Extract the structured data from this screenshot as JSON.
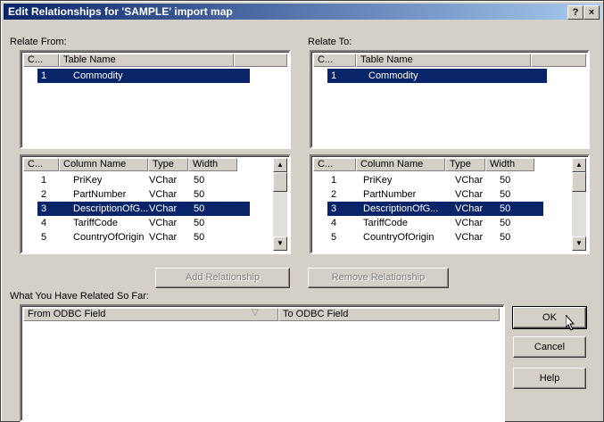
{
  "window": {
    "title": "Edit Relationships for 'SAMPLE' import map",
    "help_btn": "?",
    "close_btn": "×"
  },
  "relate_from": {
    "label": "Relate From:",
    "tables_header": [
      "C...",
      "Table Name"
    ],
    "tables": [
      {
        "c": "1",
        "name": "Commodity"
      }
    ],
    "columns_header": [
      "C...",
      "Column Name",
      "Type",
      "Width"
    ],
    "columns": [
      {
        "c": "1",
        "name": "PriKey",
        "type": "VChar",
        "width": "50"
      },
      {
        "c": "2",
        "name": "PartNumber",
        "type": "VChar",
        "width": "50"
      },
      {
        "c": "3",
        "name": "DescriptionOfG...",
        "type": "VChar",
        "width": "50"
      },
      {
        "c": "4",
        "name": "TariffCode",
        "type": "VChar",
        "width": "50"
      },
      {
        "c": "5",
        "name": "CountryOfOrigin",
        "type": "VChar",
        "width": "50"
      }
    ]
  },
  "relate_to": {
    "label": "Relate To:",
    "tables_header": [
      "C...",
      "Table Name"
    ],
    "tables": [
      {
        "c": "1",
        "name": "Commodity"
      }
    ],
    "columns_header": [
      "C...",
      "Column Name",
      "Type",
      "Width"
    ],
    "columns": [
      {
        "c": "1",
        "name": "PriKey",
        "type": "VChar",
        "width": "50"
      },
      {
        "c": "2",
        "name": "PartNumber",
        "type": "VChar",
        "width": "50"
      },
      {
        "c": "3",
        "name": "DescriptionOfG...",
        "type": "VChar",
        "width": "50"
      },
      {
        "c": "4",
        "name": "TariffCode",
        "type": "VChar",
        "width": "50"
      },
      {
        "c": "5",
        "name": "CountryOfOrigin",
        "type": "VChar",
        "width": "50"
      }
    ]
  },
  "buttons": {
    "add": "Add Relationship",
    "remove": "Remove Relationship",
    "ok": "OK",
    "cancel": "Cancel",
    "help": "Help"
  },
  "related": {
    "label": "What You Have Related So Far:",
    "col_from": "From ODBC Field",
    "col_to": "To ODBC Field"
  }
}
